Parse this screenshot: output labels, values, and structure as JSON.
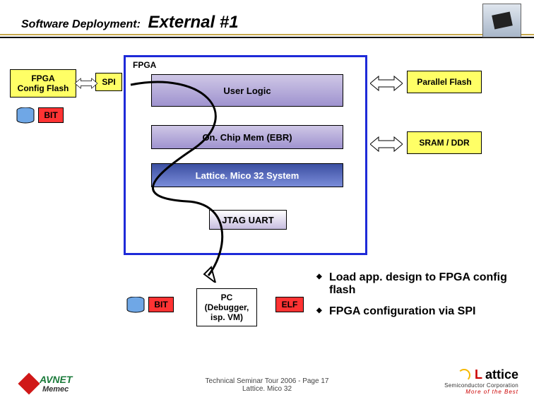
{
  "title": {
    "sub": "Software Deployment:",
    "main": "External #1"
  },
  "left": {
    "config_flash": "FPGA\nConfig Flash",
    "spi": "SPI",
    "bit": "BIT"
  },
  "fpga": {
    "label": "FPGA",
    "user_logic": "User Logic",
    "onchip": "On. Chip Mem (EBR)",
    "system": "Lattice. Mico 32 System",
    "jtag": "JTAG UART"
  },
  "right": {
    "parallel": "Parallel Flash",
    "sram": "SRAM / DDR"
  },
  "bottom": {
    "bit": "BIT",
    "pc": "PC\n(Debugger,\nisp. VM)",
    "elf": "ELF"
  },
  "bullets": {
    "b1": "Load app. design to FPGA config flash",
    "b2": "FPGA configuration via SPI"
  },
  "footer": {
    "line1": "Technical Seminar Tour 2006   -   Page 17",
    "line2": "Lattice. Mico 32"
  },
  "logos": {
    "avnet": "AVNET",
    "memec": "Memec",
    "lattice_l": "L",
    "lattice_rest": "attice",
    "lattice_sub": "Semiconductor Corporation",
    "lattice_tag": "More  of  the  Best"
  }
}
